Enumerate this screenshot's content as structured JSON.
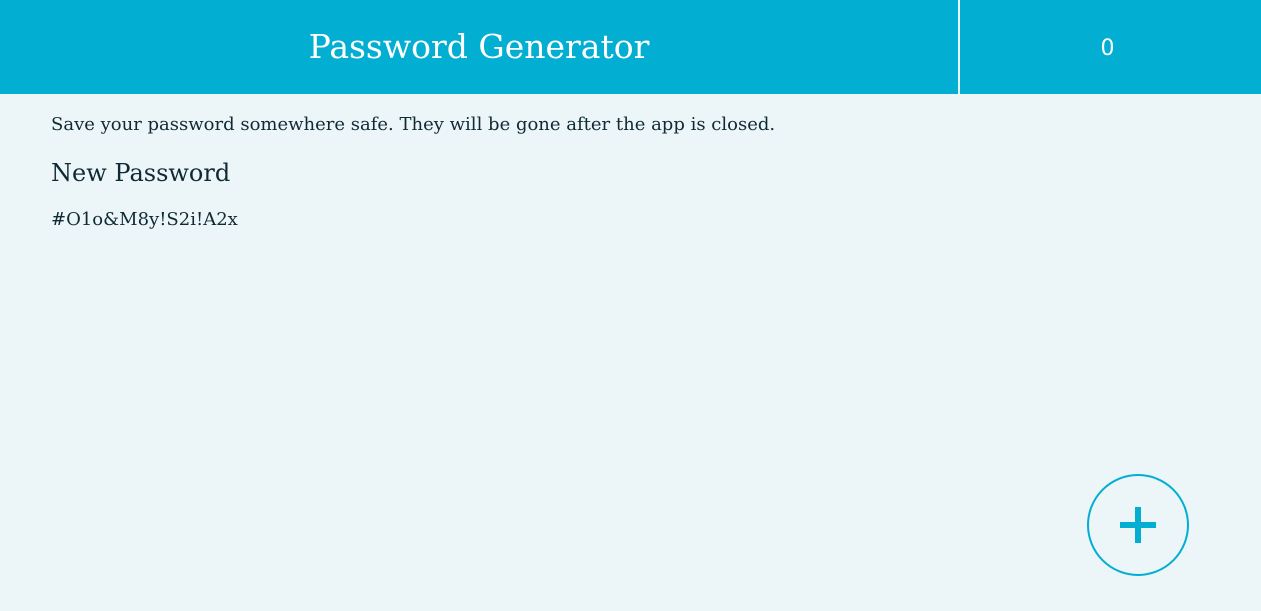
{
  "header": {
    "title": "Password Generator",
    "counter": "0"
  },
  "main": {
    "notice": "Save your password somewhere safe. They will be gone after the app is closed.",
    "section_heading": "New Password",
    "password": "#O1o&M8y!S2i!A2x"
  },
  "fab": {
    "icon": "plus-icon"
  },
  "colors": {
    "accent": "#02aed2",
    "background": "#ecf5f8",
    "text": "#0f2a33"
  }
}
